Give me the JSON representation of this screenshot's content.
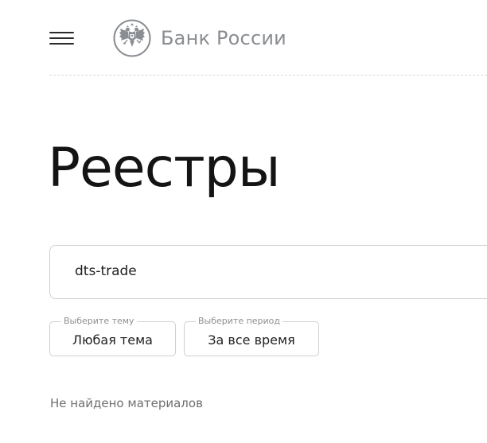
{
  "header": {
    "menu_icon": "hamburger-menu-icon",
    "logo_icon": "double-headed-eagle-emblem-icon",
    "logo_text": "Банк России"
  },
  "main": {
    "title": "Реестры",
    "search": {
      "value": "dts-trade",
      "placeholder": ""
    },
    "filters": {
      "topic": {
        "legend": "Выберите тему",
        "value": "Любая тема"
      },
      "period": {
        "legend": "Выберите период",
        "value": "За все время"
      }
    },
    "empty_message": "Не найдено материалов"
  },
  "colors": {
    "text_primary": "#141414",
    "logo_grey": "#8a8d91",
    "border": "#cfcfcf",
    "muted_text": "#6f6f6f"
  }
}
